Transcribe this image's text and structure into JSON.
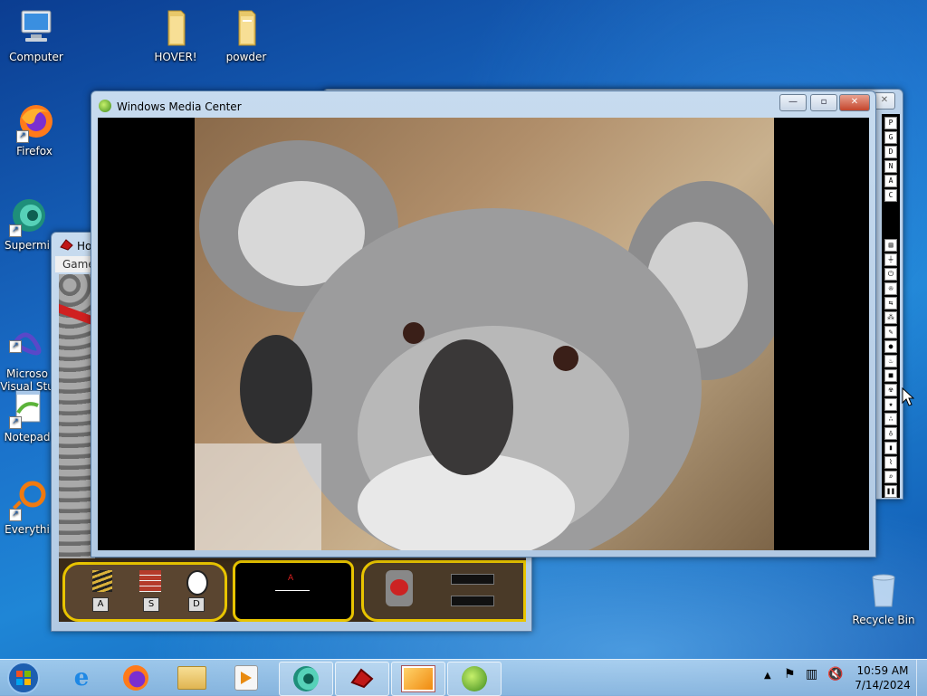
{
  "desktop": {
    "icons": [
      {
        "label": "Computer"
      },
      {
        "label": "HOVER!"
      },
      {
        "label": "powder"
      },
      {
        "label": "Firefox"
      },
      {
        "label": "Supermi"
      },
      {
        "label": "Microso\nVisual Stu"
      },
      {
        "label": "Notepad"
      },
      {
        "label": "Everythi"
      },
      {
        "label": "Recycle Bin"
      }
    ]
  },
  "media_center": {
    "title": "Windows Media Center",
    "min": "—",
    "max": "▫",
    "close": "✕"
  },
  "hover_window": {
    "title": "Ho",
    "menu": "Game",
    "keys": [
      "A",
      "S",
      "D"
    ],
    "radar_marker": "A"
  },
  "side_toolbar": {
    "letters": [
      "P",
      "G",
      "D",
      "N",
      "A",
      "C"
    ]
  },
  "taskbar": {
    "time": "10:59 AM",
    "date": "7/14/2024"
  },
  "colors": {
    "title_bar": "#b7cfe8",
    "taskbar": "#a8c8e4",
    "hover_gold": "#e8c400"
  }
}
